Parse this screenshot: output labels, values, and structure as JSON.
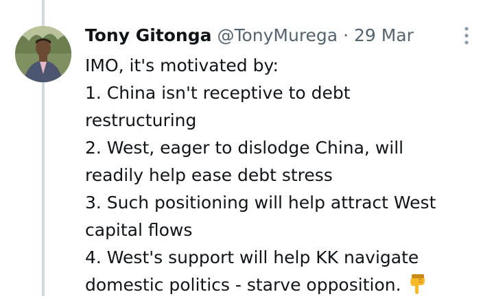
{
  "tweet": {
    "author_name": "Tony Gitonga",
    "author_handle": "@TonyMurega",
    "separator": " · ",
    "date": "29 Mar",
    "lines": [
      "IMO, it's motivated by:",
      "1. China isn't receptive to debt",
      "restructuring",
      "2. West, eager to dislodge China, will",
      "readily help ease debt stress",
      "3. Such positioning will help attract West",
      "capital flows",
      "4. West's support will help KK navigate",
      "domestic politics - starve opposition."
    ],
    "trailing_emoji": "pointing-down-hand"
  },
  "colors": {
    "text_primary": "#0f1419",
    "text_secondary": "#536471",
    "thread_line": "#cfd9de",
    "emoji_yellow": "#f7b928"
  },
  "icons": {
    "more": "more-options-icon",
    "emoji": "pointing-down-hand-emoji"
  }
}
